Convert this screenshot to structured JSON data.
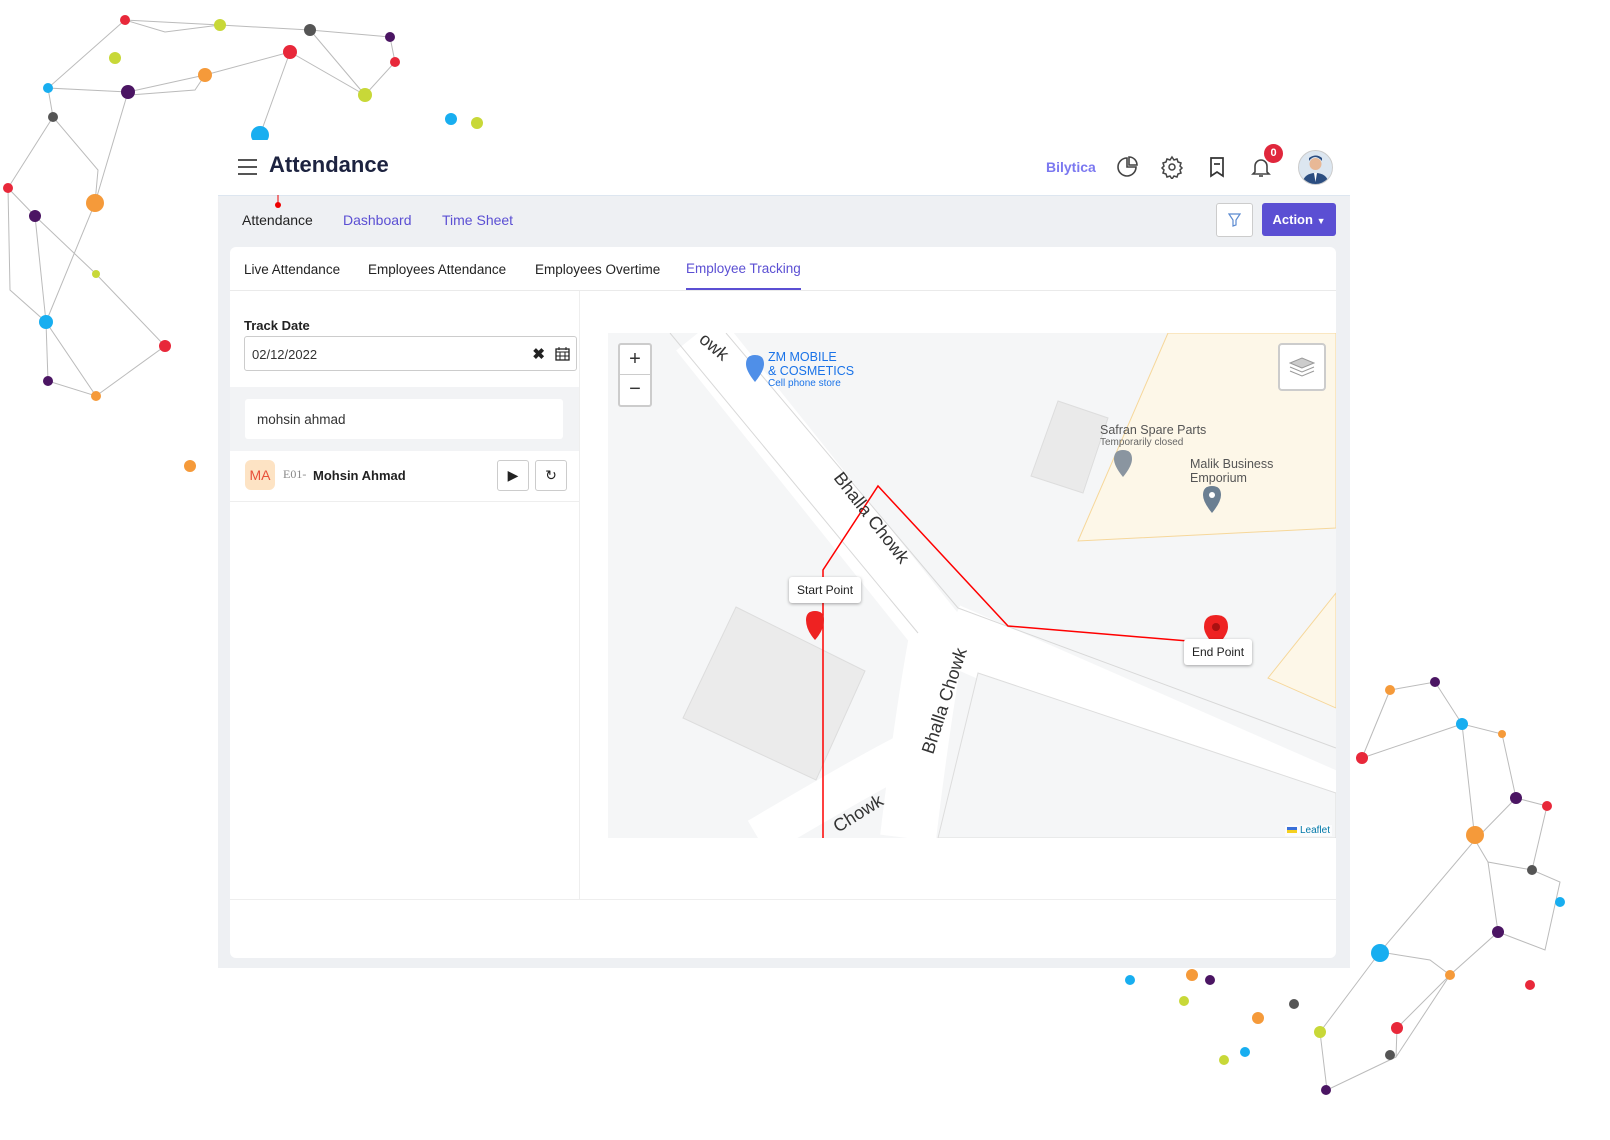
{
  "header": {
    "title": "Attendance",
    "brand": "Bilytica",
    "notification_count": "0",
    "icons": [
      "menu-icon",
      "pie-chart-icon",
      "gear-icon",
      "bookmark-icon",
      "bell-icon",
      "avatar"
    ]
  },
  "subnav": {
    "items": [
      "Attendance",
      "Dashboard",
      "Time Sheet"
    ],
    "active": "Attendance",
    "action_label": "Action"
  },
  "tabs": {
    "items": [
      "Live Attendance",
      "Employees Attendance",
      "Employees Overtime",
      "Employee Tracking"
    ],
    "active": "Employee Tracking"
  },
  "filters": {
    "track_date_label": "Track Date",
    "track_date_value": "02/12/2022",
    "search_value": "mohsin ahmad"
  },
  "employees": [
    {
      "initials": "MA",
      "code": "E01-",
      "name": "Mohsin Ahmad"
    }
  ],
  "map": {
    "streets": [
      "Bhalla Chowk",
      "Bhalla Chowk",
      "Chowk",
      "owk"
    ],
    "places": [
      {
        "name_line1": "ZM MOBILE",
        "name_line2": "& COSMETICS",
        "category": "Cell phone store"
      },
      {
        "name": "Safran Spare Parts",
        "status": "Temporarily closed"
      },
      {
        "name_line1": "Malik Business",
        "name_line2": "Emporium"
      }
    ],
    "start_label": "Start Point",
    "end_label": "End Point",
    "attribution": "Leaflet",
    "route_color": "#ff0000"
  },
  "colors": {
    "accent": "#5b4fd3",
    "link": "#5b4fd3",
    "badge": "#e0273c"
  }
}
